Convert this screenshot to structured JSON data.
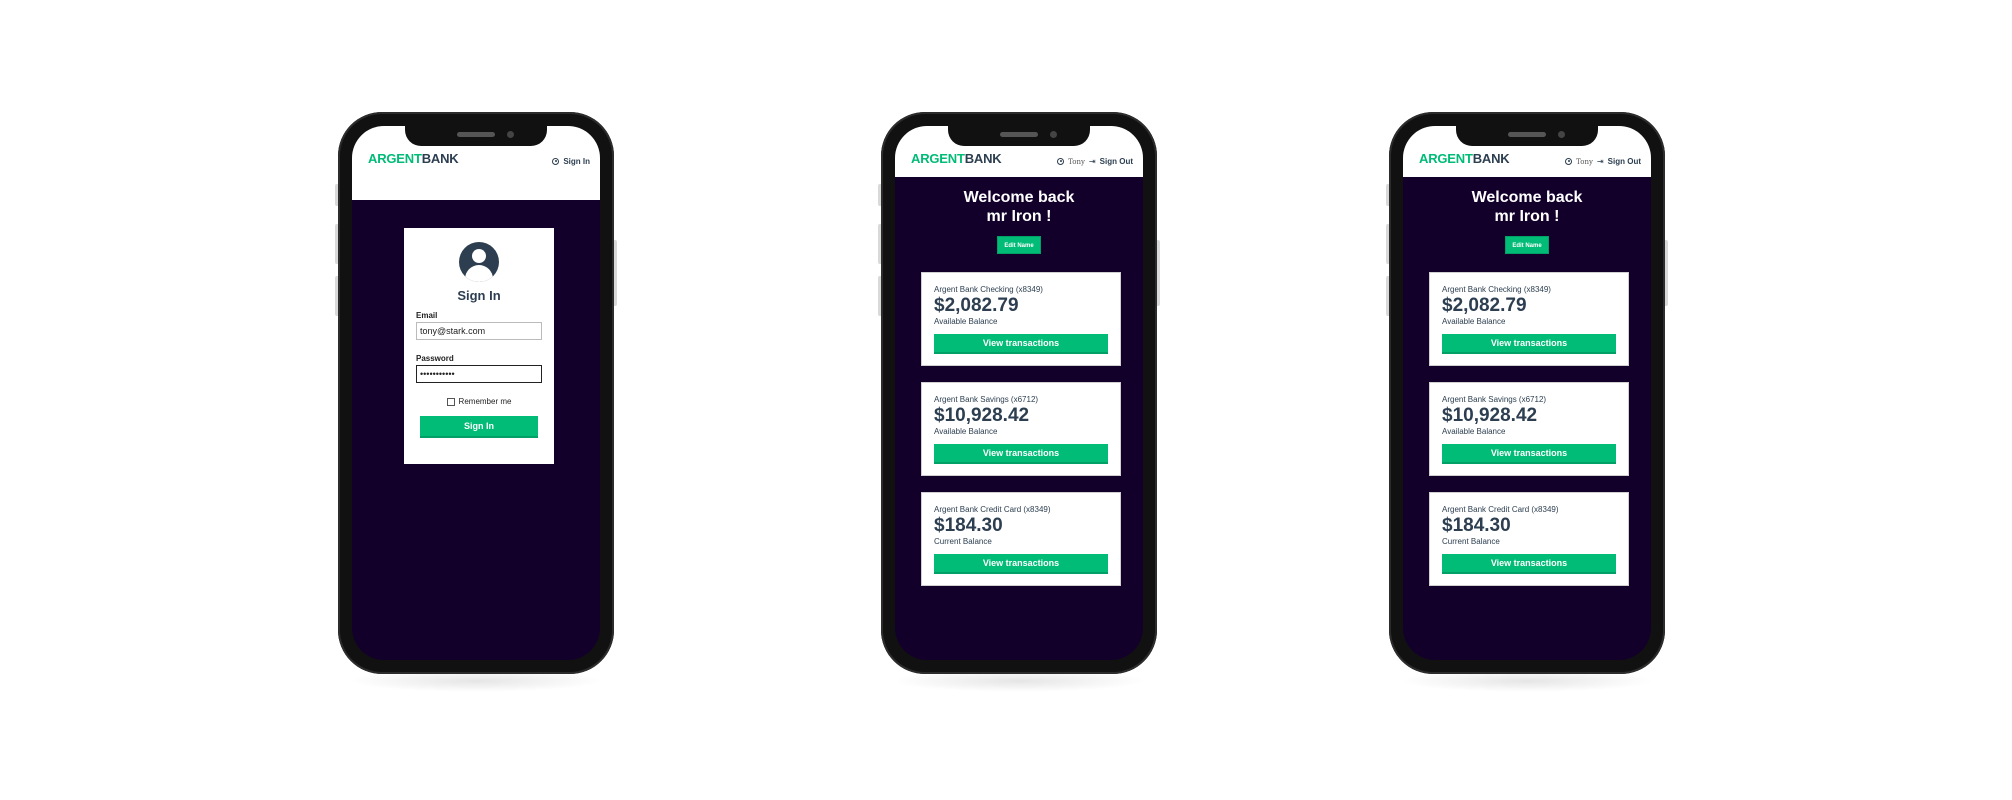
{
  "brand": {
    "logo_part1": "ARGENT",
    "logo_part2": "BANK",
    "primary": "#00bc77",
    "dark": "#2c3e50",
    "bg": "#12002b"
  },
  "signin_page": {
    "nav_signin": "Sign In",
    "title": "Sign In",
    "email_label": "Email",
    "email_value": "tony@stark.com",
    "password_label": "Password",
    "password_value": "•••••••••••",
    "remember_label": "Remember me",
    "button": "Sign In"
  },
  "user_page": {
    "nav_user": "Tony",
    "nav_signout": "Sign Out",
    "welcome_line1": "Welcome back",
    "welcome_line2": "mr Iron !",
    "edit_button": "Edit Name",
    "accounts": [
      {
        "title": "Argent Bank Checking (x8349)",
        "amount": "$2,082.79",
        "desc": "Available Balance",
        "button": "View transactions"
      },
      {
        "title": "Argent Bank Savings (x6712)",
        "amount": "$10,928.42",
        "desc": "Available Balance",
        "button": "View transactions"
      },
      {
        "title": "Argent Bank Credit Card (x8349)",
        "amount": "$184.30",
        "desc": "Current Balance",
        "button": "View transactions"
      }
    ]
  }
}
